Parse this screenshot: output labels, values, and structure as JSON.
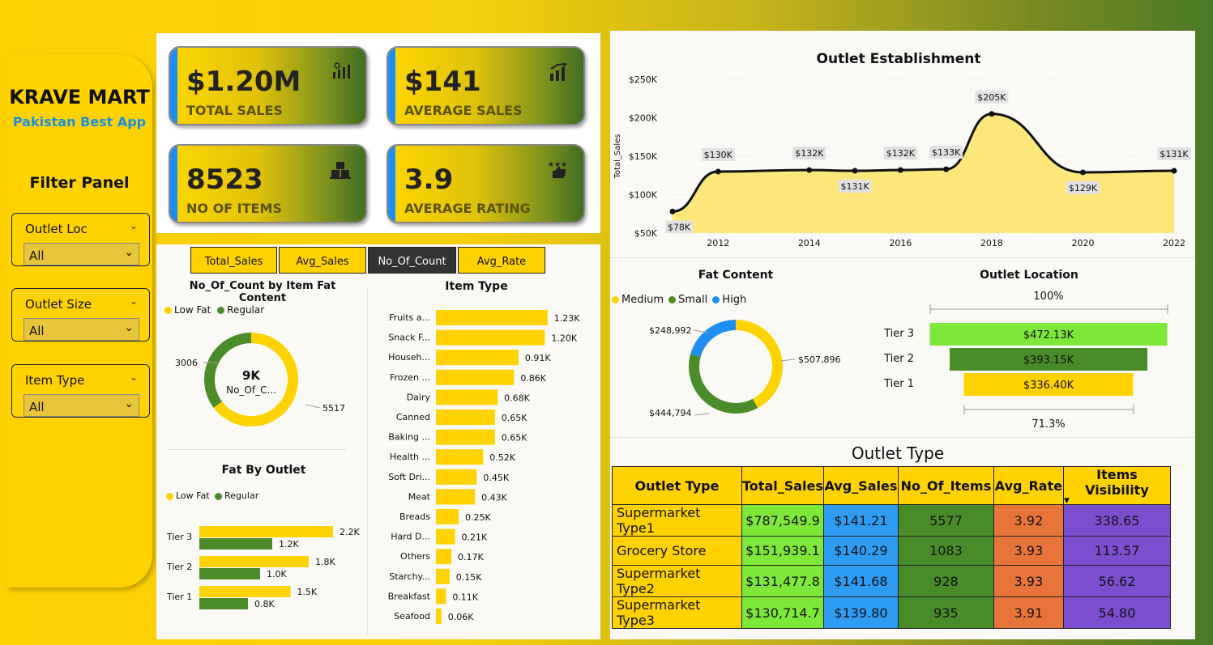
{
  "brand": {
    "title": "KRAVE MART",
    "tagline": "Pakistan Best App"
  },
  "filter_panel": {
    "title": "Filter Panel",
    "slicers": [
      {
        "label": "Outlet Loc",
        "value": "All"
      },
      {
        "label": "Outlet Size",
        "value": "All"
      },
      {
        "label": "Item Type",
        "value": "All"
      }
    ]
  },
  "kpis": [
    {
      "value": "$1.20M",
      "label": "TOTAL SALES",
      "icon": "bar-chart-icon"
    },
    {
      "value": "$141",
      "label": "AVERAGE SALES",
      "icon": "growth-chart-icon"
    },
    {
      "value": "8523",
      "label": "NO OF ITEMS",
      "icon": "boxes-icon"
    },
    {
      "value": "3.9",
      "label": "AVERAGE RATING",
      "icon": "thumbs-up-stars-icon"
    }
  ],
  "measure_buttons": [
    "Total_Sales",
    "Avg_Sales",
    "No_Of_Count",
    "Avg_Rate"
  ],
  "active_measure": "No_Of_Count",
  "fat_content_donut": {
    "title": "No_Of_Count by Item Fat Content",
    "legend": [
      "Low Fat",
      "Regular"
    ],
    "center_value": "9K",
    "center_label": "No_Of_C...",
    "values": [
      5517,
      3006
    ],
    "labels": [
      "5517",
      "3006"
    ],
    "colors": [
      "#ffd200",
      "#4a8c2a"
    ]
  },
  "fat_by_outlet": {
    "title": "Fat By Outlet",
    "legend": [
      "Low Fat",
      "Regular"
    ],
    "categories": [
      "Tier 3",
      "Tier 2",
      "Tier 1"
    ],
    "low_fat": [
      2.2,
      1.8,
      1.5
    ],
    "regular": [
      1.2,
      1.0,
      0.8
    ],
    "low_fat_labels": [
      "2.2K",
      "1.8K",
      "1.5K"
    ],
    "regular_labels": [
      "1.2K",
      "1.0K",
      "0.8K"
    ]
  },
  "item_type": {
    "title": "Item Type",
    "categories": [
      "Fruits a...",
      "Snack F...",
      "Househ...",
      "Frozen ...",
      "Dairy",
      "Canned",
      "Baking ...",
      "Health ...",
      "Soft Dri...",
      "Meat",
      "Breads",
      "Hard D...",
      "Others",
      "Starchy...",
      "Breakfast",
      "Seafood"
    ],
    "values": [
      1.23,
      1.2,
      0.91,
      0.86,
      0.68,
      0.65,
      0.65,
      0.52,
      0.45,
      0.43,
      0.25,
      0.21,
      0.17,
      0.15,
      0.11,
      0.06
    ],
    "labels": [
      "1.23K",
      "1.20K",
      "0.91K",
      "0.86K",
      "0.68K",
      "0.65K",
      "0.65K",
      "0.52K",
      "0.45K",
      "0.43K",
      "0.25K",
      "0.21K",
      "0.17K",
      "0.15K",
      "0.11K",
      "0.06K"
    ]
  },
  "chart_data": {
    "type": "area",
    "title": "Outlet Establishment",
    "ylabel": "Total_Sales",
    "x": [
      2011,
      2012,
      2014,
      2015,
      2016,
      2017,
      2018,
      2020,
      2022
    ],
    "values": [
      78,
      130,
      132,
      131,
      132,
      133,
      205,
      129,
      131
    ],
    "point_labels": [
      "$78K",
      "$130K",
      "$132K",
      "$131K",
      "$132K",
      "$133K",
      "$205K",
      "$129K",
      "$131K"
    ],
    "x_ticks": [
      "2012",
      "2014",
      "2016",
      "2018",
      "2020",
      "2022"
    ],
    "y_ticks": [
      "$50K",
      "$100K",
      "$150K",
      "$200K",
      "$250K"
    ],
    "ylim": [
      50,
      250
    ]
  },
  "fat_content": {
    "title": "Fat Content",
    "legend": [
      "Medium",
      "Small",
      "High"
    ],
    "values": [
      507896,
      444794,
      248992
    ],
    "labels": [
      "$507,896",
      "$444,794",
      "$248,992"
    ],
    "colors": [
      "#ffd200",
      "#4a8c2a",
      "#1f8ef0"
    ]
  },
  "outlet_location": {
    "title": "Outlet Location",
    "top_pct": "100%",
    "bottom_pct": "71.3%",
    "tiers": [
      "Tier 3",
      "Tier 2",
      "Tier 1"
    ],
    "values": [
      472.13,
      393.15,
      336.4
    ],
    "labels": [
      "$472.13K",
      "$393.15K",
      "$336.40K"
    ],
    "colors": [
      "#7ee83a",
      "#4a8c2a",
      "#ffd200"
    ]
  },
  "outlet_type": {
    "title": "Outlet Type",
    "columns": [
      "Outlet Type",
      "Total_Sales",
      "Avg_Sales",
      "No_Of_Items",
      "Avg_Rate",
      "Items Visibility"
    ],
    "rows": [
      [
        "Supermarket Type1",
        "$787,549.9",
        "$141.21",
        "5577",
        "3.92",
        "338.65"
      ],
      [
        "Grocery Store",
        "$151,939.1",
        "$140.29",
        "1083",
        "3.93",
        "113.57"
      ],
      [
        "Supermarket Type2",
        "$131,477.8",
        "$141.68",
        "928",
        "3.93",
        "56.62"
      ],
      [
        "Supermarket Type3",
        "$130,714.7",
        "$139.80",
        "935",
        "3.91",
        "54.80"
      ]
    ],
    "column_colors": [
      "#ffd200",
      "#7ee83a",
      "#2f9cf4",
      "#4a8c2a",
      "#e8743b",
      "#7b4fd0"
    ]
  }
}
